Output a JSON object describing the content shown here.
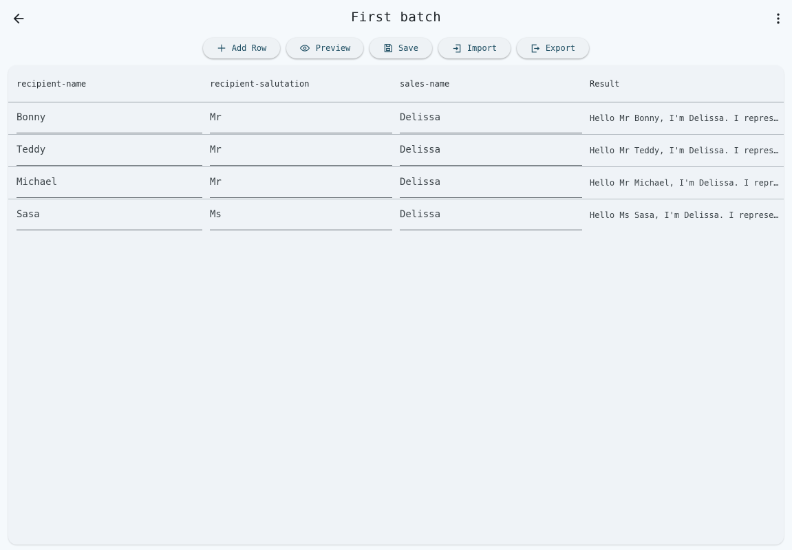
{
  "appbar": {
    "title": "First batch",
    "back_icon": "arrow-left-icon",
    "more_icon": "more-vert-icon"
  },
  "toolbar": {
    "buttons": [
      {
        "label": "Add Row",
        "icon": "plus-icon"
      },
      {
        "label": "Preview",
        "icon": "eye-icon"
      },
      {
        "label": "Save",
        "icon": "floppy-disk-icon"
      },
      {
        "label": "Import",
        "icon": "import-icon"
      },
      {
        "label": "Export",
        "icon": "export-icon"
      }
    ]
  },
  "table": {
    "columns": [
      "recipient-name",
      "recipient-salutation",
      "sales-name",
      "Result"
    ],
    "rows": [
      {
        "recipient_name": "Bonny",
        "recipient_salutation": "Mr",
        "sales_name": "Delissa",
        "result": "Hello Mr Bonny, I'm Delissa. I repres…"
      },
      {
        "recipient_name": "Teddy",
        "recipient_salutation": "Mr",
        "sales_name": "Delissa",
        "result": "Hello Mr Teddy, I'm Delissa. I repres…"
      },
      {
        "recipient_name": "Michael",
        "recipient_salutation": "Mr",
        "sales_name": "Delissa",
        "result": "Hello Mr Michael, I'm Delissa. I repr…"
      },
      {
        "recipient_name": "Sasa",
        "recipient_salutation": "Ms",
        "sales_name": "Delissa",
        "result": "Hello Ms Sasa, I'm Delissa. I represe…"
      }
    ]
  },
  "colors": {
    "background": "#f5f9fc",
    "card": "#eff3f7",
    "button_text": "#1f4f63"
  }
}
